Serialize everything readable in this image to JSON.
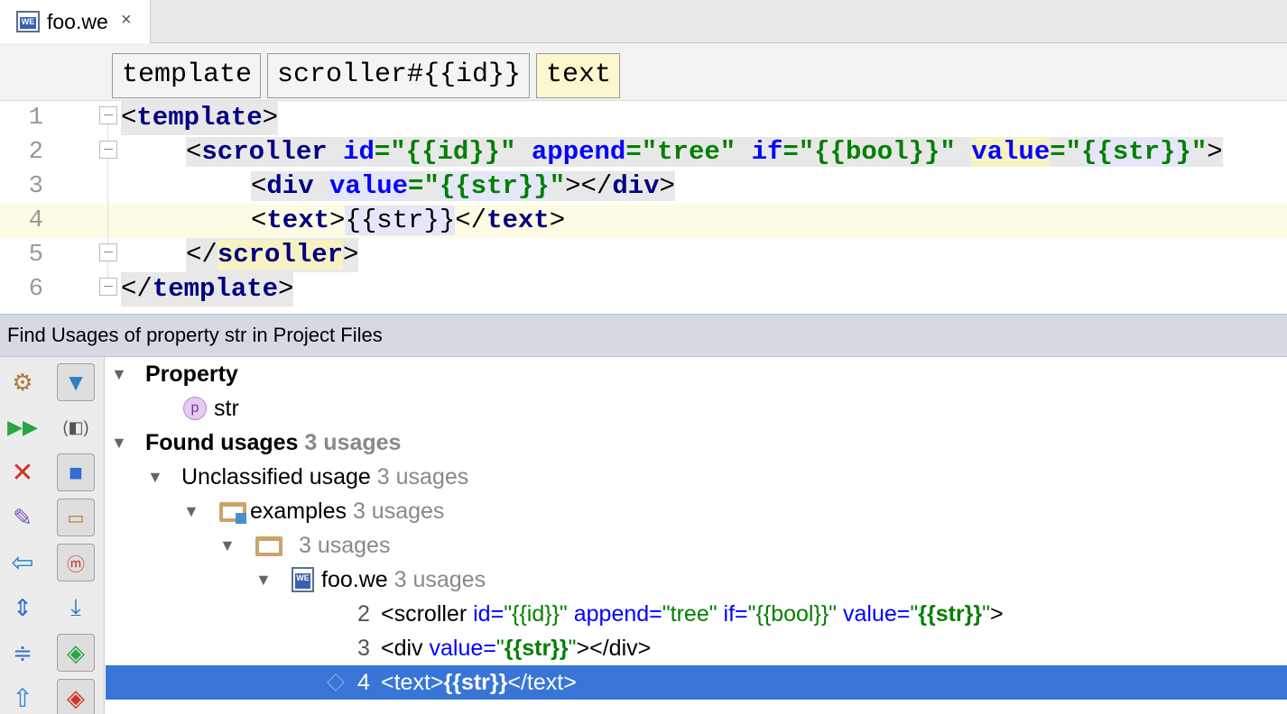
{
  "tab": {
    "label": "foo.we",
    "close": "×",
    "icon_text": "WE"
  },
  "breadcrumbs": [
    "template",
    "scroller#{{id}}",
    "text"
  ],
  "editor": {
    "line_numbers": [
      "1",
      "2",
      "3",
      "4",
      "5",
      "6"
    ],
    "line1": {
      "open": "<",
      "tag": "template",
      "close": ">"
    },
    "line2": {
      "open": "<",
      "tag": "scroller",
      "a1": "id",
      "v1": "=\"{{id}}\"",
      "a2": "append",
      "v2": "=\"tree\"",
      "a3": "if",
      "v3": "=\"{{bool}}\"",
      "a4": "value",
      "eq": "=\"",
      "v4": "{{str}}",
      "q": "\"",
      "close": ">"
    },
    "line3": {
      "open": "<",
      "tag": "div",
      "a1": "value",
      "eq": "=\"",
      "v1": "{{str}}",
      "q": "\"",
      "mid": "></",
      "tag2": "div",
      "close": ">"
    },
    "line4": {
      "open": "<",
      "tag": "text",
      "mid1": ">",
      "body": "{{str}}",
      "mid2": "</",
      "tag2": "text",
      "close": ">"
    },
    "line5": {
      "open": "</",
      "tag": "scroller",
      "close": ">"
    },
    "line6": {
      "open": "</",
      "tag": "template",
      "close": ">"
    }
  },
  "find_panel": {
    "title": "Find Usages of property str in Project Files",
    "tree": {
      "property_header": "Property",
      "property_icon": "p",
      "property_name": "str",
      "found_label": "Found usages",
      "found_count": "3 usages",
      "unclassified_label": "Unclassified usage",
      "unclassified_count": "3 usages",
      "folder_label": "examples",
      "folder_count": "3 usages",
      "subfolder_count": "3 usages",
      "file_label": "foo.we",
      "file_count": "3 usages",
      "usages": [
        {
          "line": "2",
          "t1": "<scroller ",
          "a1": "id=",
          "v1": "\"{{id}}\"",
          "a2": " append=",
          "v2": "\"tree\"",
          "a3": " if=",
          "v3": "\"{{bool}}\"",
          "a4": " value=",
          "q1": "\"",
          "hl": "{{str}}",
          "q2": "\"",
          "end": ">"
        },
        {
          "line": "3",
          "t1": "<div ",
          "a1": "value=",
          "q1": "\"",
          "hl": "{{str}}",
          "q2": "\"",
          "end": "></div>"
        },
        {
          "line": "4",
          "t1": "<text>",
          "hl": "{{str}}",
          "end": "</text>"
        }
      ]
    }
  },
  "toolbar_icons": [
    "settings-icon",
    "filter-icon",
    "run-icon",
    "preview-icon",
    "close-icon",
    "stop-icon",
    "pin-icon",
    "group-icon",
    "back-icon",
    "module-icon",
    "expand-all-icon",
    "scroll-source-icon",
    "collapse-all-icon",
    "next-occurrence-icon",
    "up-icon",
    "prev-occurrence-icon"
  ]
}
